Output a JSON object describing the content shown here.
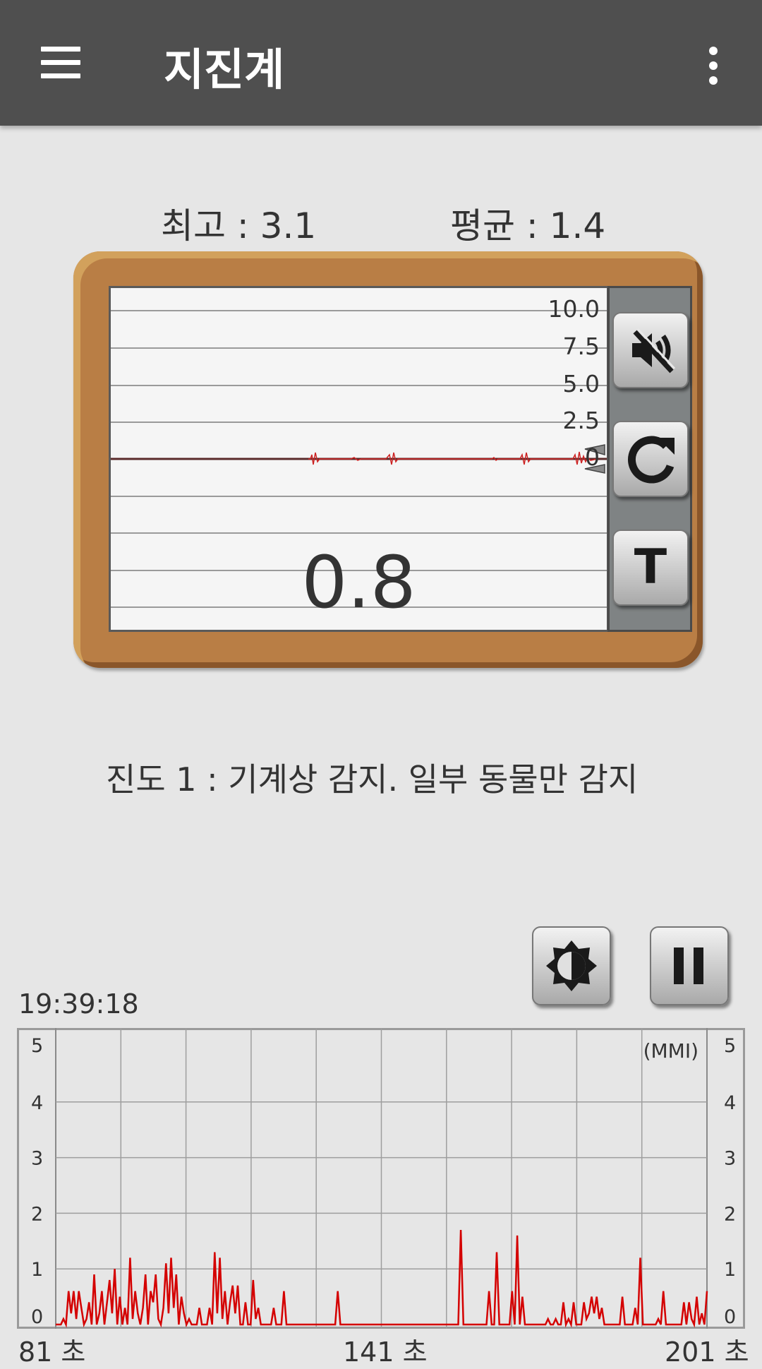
{
  "app_bar": {
    "title": "지진계",
    "menu_icon": "hamburger-menu-icon",
    "more_icon": "more-vert-icon"
  },
  "stats": {
    "max_label": "최고 : 3.1",
    "avg_label": "평균 : 1.4"
  },
  "meter": {
    "scale_labels": [
      "10.0",
      "7.5",
      "5.0",
      "2.5",
      "0"
    ],
    "reading": "0.8",
    "buttons": {
      "mute_icon": "speaker-muted-icon",
      "reset_icon": "refresh-icon",
      "text_icon": "text-t-icon",
      "text_label": "T"
    }
  },
  "intensity_text": "진도 1 : 기계상 감지. 일부 동물만 감지",
  "controls": {
    "brightness_icon": "brightness-icon",
    "pause_icon": "pause-icon"
  },
  "history": {
    "time": "19:39:18",
    "unit_label": "(MMI)",
    "x_labels": [
      "81 초",
      "141 초",
      "201 초"
    ],
    "y_labels": [
      "5",
      "4",
      "3",
      "2",
      "1",
      "0"
    ]
  },
  "colors": {
    "appbar": "#4f4f4f",
    "frame": "#b97e45",
    "signal": "#d40000"
  },
  "chart_data": {
    "type": "line",
    "x_start": 81,
    "x_end": 201,
    "ylim": [
      0,
      5
    ],
    "ylabel": "(MMI)",
    "series": [
      {
        "values": [
          0,
          0,
          0,
          0.1,
          0,
          0.6,
          0.2,
          0.6,
          0.1,
          0.6,
          0.3,
          0,
          0.1,
          0.4,
          0,
          0.9,
          0,
          0.2,
          0.6,
          0,
          0.4,
          0.8,
          0.2,
          1.0,
          0,
          0.5,
          0,
          0.3,
          0,
          1.2,
          0.1,
          0.6,
          0.2,
          0,
          0.3,
          0.9,
          0,
          0.6,
          0.4,
          0.9,
          0.1,
          0,
          0.3,
          1.1,
          0.2,
          1.2,
          0.3,
          0.9,
          0,
          0.5,
          0.2,
          0,
          0.1,
          0,
          0,
          0,
          0.3,
          0,
          0,
          0,
          0.3,
          0,
          1.3,
          0.2,
          1.2,
          0.1,
          0.6,
          0,
          0.4,
          0.7,
          0.2,
          0.7,
          0,
          0,
          0.4,
          0,
          0,
          0.8,
          0.1,
          0.3,
          0,
          0,
          0,
          0,
          0,
          0.3,
          0,
          0,
          0,
          0.6,
          0,
          0,
          0,
          0,
          0,
          0,
          0,
          0,
          0,
          0,
          0,
          0,
          0,
          0,
          0,
          0,
          0,
          0,
          0,
          0,
          0.6,
          0,
          0,
          0,
          0,
          0,
          0,
          0,
          0,
          0,
          0,
          0,
          0,
          0,
          0,
          0,
          0,
          0,
          0,
          0,
          0,
          0,
          0,
          0,
          0,
          0,
          0,
          0,
          0,
          0,
          0,
          0,
          0,
          0,
          0,
          0,
          0,
          0,
          0,
          0,
          0,
          0,
          0,
          0,
          0,
          0,
          0,
          0,
          1.7,
          0,
          0,
          0,
          0,
          0,
          0,
          0,
          0,
          0,
          0,
          0.6,
          0,
          0,
          1.3,
          0,
          0,
          0,
          0,
          0,
          0.6,
          0,
          1.6,
          0,
          0.5,
          0,
          0,
          0,
          0,
          0,
          0,
          0,
          0,
          0,
          0.1,
          0,
          0,
          0.1,
          0,
          0,
          0.4,
          0,
          0.1,
          0,
          0.4,
          0,
          0,
          0,
          0.4,
          0.1,
          0.2,
          0.5,
          0.2,
          0.5,
          0.1,
          0.3,
          0,
          0,
          0,
          0,
          0,
          0,
          0,
          0.5,
          0,
          0,
          0,
          0,
          0.3,
          0,
          1.2,
          0,
          0,
          0,
          0,
          0,
          0,
          0.1,
          0,
          0.6,
          0,
          0,
          0,
          0,
          0,
          0,
          0,
          0.4,
          0,
          0.4,
          0.1,
          0,
          0.5,
          0,
          0.2,
          0,
          0.6
        ]
      }
    ]
  }
}
